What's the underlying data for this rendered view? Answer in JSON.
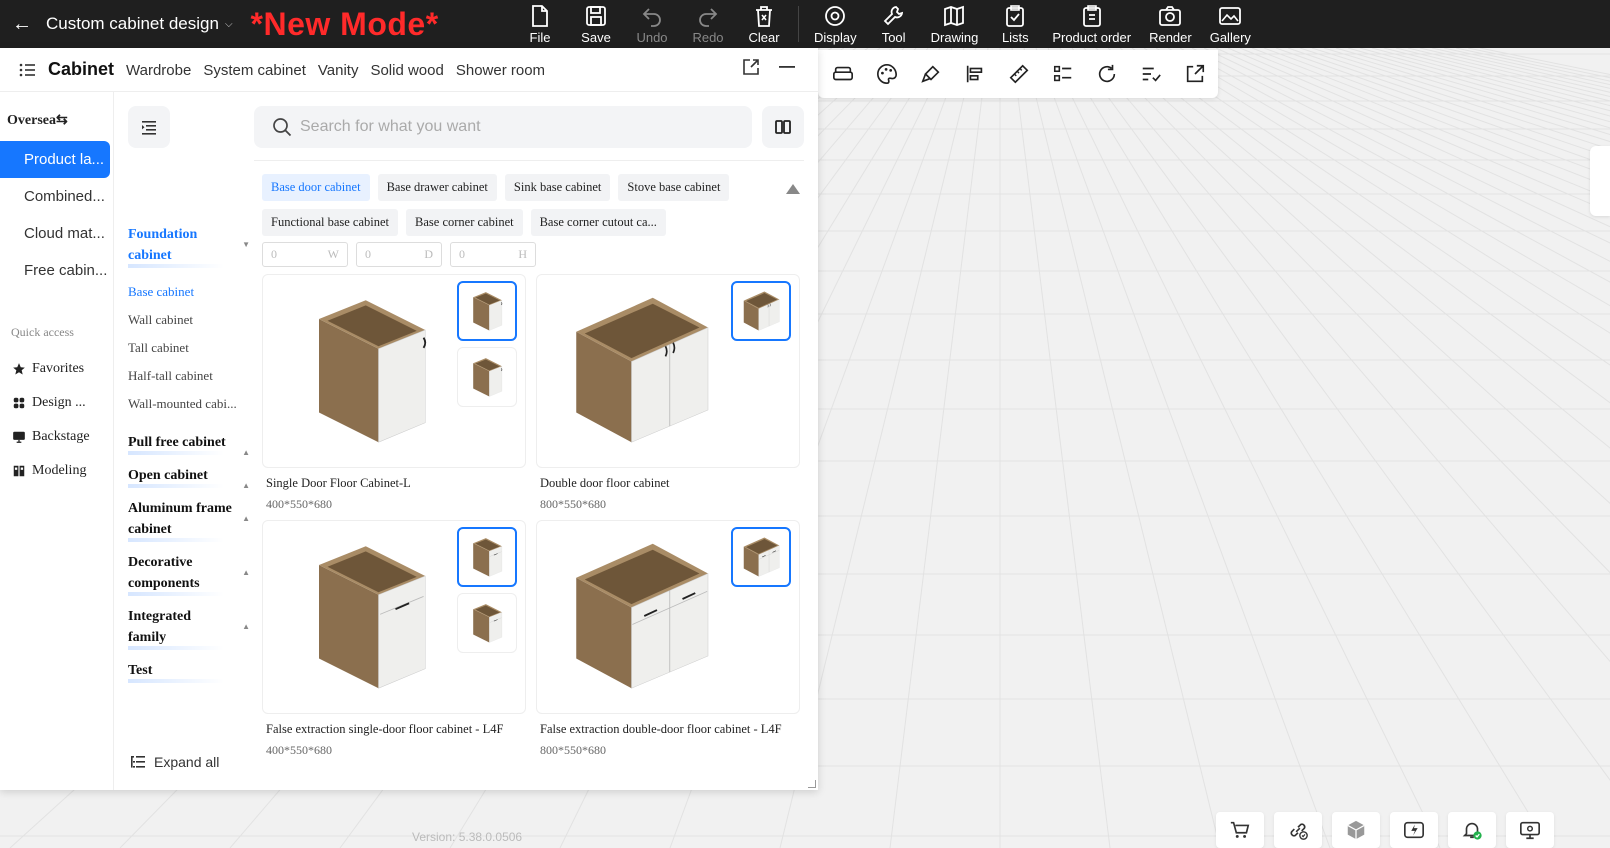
{
  "header": {
    "back_icon": "arrow-left-icon",
    "title": "Custom cabinet design",
    "mode": "*New Mode*",
    "tools": [
      {
        "label": "File",
        "icon": "file-icon",
        "enabled": true
      },
      {
        "label": "Save",
        "icon": "save-icon",
        "enabled": true
      },
      {
        "label": "Undo",
        "icon": "undo-icon",
        "enabled": false
      },
      {
        "label": "Redo",
        "icon": "redo-icon",
        "enabled": false
      },
      {
        "label": "Clear",
        "icon": "clear-icon",
        "enabled": true
      },
      {
        "label": "Display",
        "icon": "eye-icon",
        "enabled": true
      },
      {
        "label": "Tool",
        "icon": "wrench-icon",
        "enabled": true
      },
      {
        "label": "Drawing",
        "icon": "map-icon",
        "enabled": true
      },
      {
        "label": "Lists",
        "icon": "clipboard-check-icon",
        "enabled": true
      },
      {
        "label": "Product order",
        "icon": "clipboard-order-icon",
        "enabled": true
      },
      {
        "label": "Render",
        "icon": "camera-icon",
        "enabled": true
      },
      {
        "label": "Gallery",
        "icon": "image-icon",
        "enabled": true
      }
    ]
  },
  "panel": {
    "tabs": [
      "Cabinet",
      "Wardrobe",
      "System cabinet",
      "Vanity",
      "Solid wood",
      "Shower room"
    ],
    "active_tab": "Cabinet",
    "region": "Oversea⇆",
    "left_nav": [
      {
        "label": "Product la...",
        "active": true
      },
      {
        "label": "Combined...",
        "active": false
      },
      {
        "label": "Cloud mat...",
        "active": false
      },
      {
        "label": "Free cabin...",
        "active": false
      }
    ],
    "quick_access_title": "Quick access",
    "quick_access": [
      {
        "label": "Favorites",
        "icon": "star-icon"
      },
      {
        "label": "Design ...",
        "icon": "grid-icon"
      },
      {
        "label": "Backstage",
        "icon": "monitor-icon"
      },
      {
        "label": "Modeling",
        "icon": "cube-icon"
      }
    ],
    "categories": [
      {
        "label": "Foundation cabinet",
        "active": true,
        "expanded": true,
        "subs": [
          "Base cabinet",
          "Wall cabinet",
          "Tall cabinet",
          "Half-tall cabinet",
          "Wall-mounted cabi..."
        ]
      },
      {
        "label": "Pull free cabinet",
        "active": false,
        "expanded": false
      },
      {
        "label": "Open cabinet",
        "active": false,
        "expanded": false
      },
      {
        "label": "Aluminum frame cabinet",
        "active": false,
        "expanded": false
      },
      {
        "label": "Decorative components",
        "active": false,
        "expanded": false
      },
      {
        "label": "Integrated family",
        "active": false,
        "expanded": false
      },
      {
        "label": "Test",
        "active": false,
        "expanded": null
      }
    ],
    "active_sub": "Base cabinet",
    "expand_all": "Expand all",
    "search_placeholder": "Search for what you want",
    "chips": [
      "Base door cabinet",
      "Base drawer cabinet",
      "Sink base cabinet",
      "Stove base cabinet",
      "Functional base cabinet",
      "Base corner cabinet",
      "Base corner cutout ca..."
    ],
    "active_chip": "Base door cabinet",
    "dims": [
      {
        "value": "0",
        "unit": "W"
      },
      {
        "value": "0",
        "unit": "D"
      },
      {
        "value": "0",
        "unit": "H"
      }
    ],
    "products": [
      {
        "name": "Single Door Floor Cabinet-L",
        "size": "400*550*680",
        "thumbs": 2,
        "variant": "single-door"
      },
      {
        "name": "Double door floor cabinet",
        "size": "800*550*680",
        "thumbs": 1,
        "variant": "double-door"
      },
      {
        "name": "False extraction single-door floor cabinet - L4F",
        "size": "400*550*680",
        "thumbs": 2,
        "variant": "single-drawer"
      },
      {
        "name": "False extraction double-door floor cabinet - L4F",
        "size": "800*550*680",
        "thumbs": 1,
        "variant": "double-drawer"
      }
    ]
  },
  "float_toolbar": [
    "sofa-icon",
    "palette-icon",
    "brush-icon",
    "align-left-icon",
    "ruler-icon",
    "list-grid-icon",
    "rotate-icon",
    "checklist-icon",
    "export-icon"
  ],
  "version": "Version: 5.38.0.0506",
  "bottom_dock": [
    "cart-icon",
    "link-check-icon",
    "box-icon",
    "lightning-icon",
    "bell-check-icon",
    "monitor-settings-icon"
  ],
  "colors": {
    "topbar": "#1f1f1f",
    "accent": "#1677ff",
    "mode": "#ff2a2a",
    "wood": "#8b6f4e",
    "door": "#efefed"
  }
}
